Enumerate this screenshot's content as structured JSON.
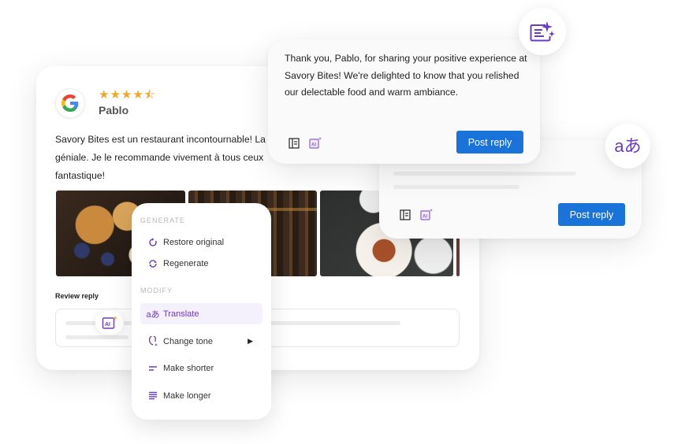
{
  "review": {
    "source": "google-icon",
    "rating": 4.5,
    "rating_max": 5,
    "stars": "★★★★⯪",
    "reviewer_name": "Pablo",
    "text_lines": [
      "Savory Bites est un restaurant incontournable! La",
      "géniale. Je le recommande vivement à tous ceux",
      "fantastique!"
    ],
    "photos": [
      "food-photo-french-toast",
      "restaurant-interior-photo",
      "table-dishes-photo"
    ],
    "reply_label": "Review reply"
  },
  "reply_card_1": {
    "text": "Thank you, Pablo, for sharing your positive experience at Savory Bites! We're delighted to know that you relished our delectable food and warm ambiance.",
    "post_button": "Post reply"
  },
  "reply_card_2": {
    "post_button": "Post reply"
  },
  "floating_icons": {
    "top": "ai-sparkle-text-icon",
    "translate": "aあ"
  },
  "menu": {
    "generate_header": "GENERATE",
    "generate_items": [
      {
        "label": "Restore original",
        "icon": "restore-icon"
      },
      {
        "label": "Regenerate",
        "icon": "regenerate-icon"
      }
    ],
    "modify_header": "MODIFY",
    "modify_items": [
      {
        "label": "Translate",
        "icon": "translate-icon",
        "active": true
      },
      {
        "label": "Change tone",
        "icon": "tone-icon",
        "has_submenu": true
      },
      {
        "label": "Make shorter",
        "icon": "shorter-icon"
      },
      {
        "label": "Make longer",
        "icon": "longer-icon"
      }
    ],
    "translate_glyph": "aあ",
    "submenu_arrow": "▶"
  },
  "colors": {
    "accent_purple": "#6a3bc6",
    "button_blue": "#1a73d9",
    "star_orange": "#f5a623"
  }
}
